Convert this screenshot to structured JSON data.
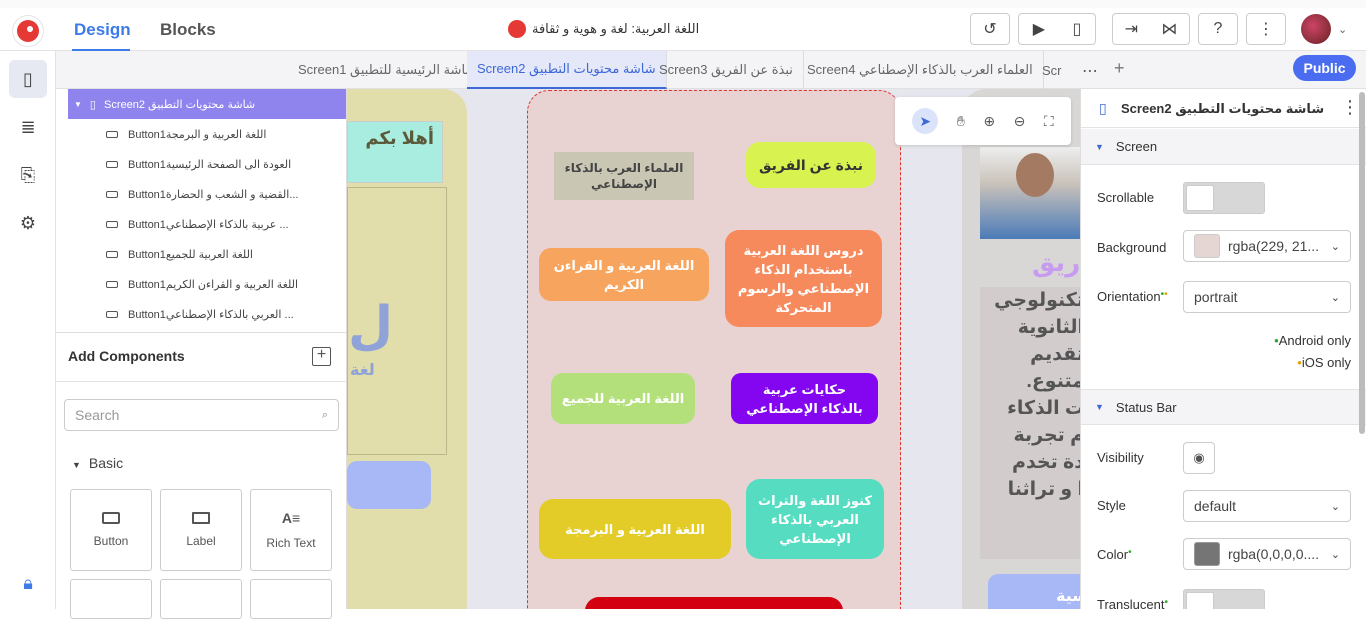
{
  "header": {
    "tabs": [
      "Design",
      "Blocks"
    ],
    "app_title": "اللغة العربية: لغة و هوية و ثقافة",
    "icons": [
      "history-icon",
      "preview-icon",
      "device-icon",
      "export-icon",
      "share-icon",
      "help-icon",
      "more-vert-icon"
    ]
  },
  "rail": {
    "icons": [
      "screen-icon",
      "database-icon",
      "assets-icon",
      "settings-icon",
      "lock-icon"
    ]
  },
  "screen_tabs": [
    "Screen1 الشاشة الرئيسية للتطبيق",
    "Screen2 شاشة محتويات التطبيق",
    "Screen3 نبذة عن الفريق",
    "Screen4 العلماء العرب بالذكاء الإصطناعي",
    "Scr"
  ],
  "publish_label": "Public",
  "tree": {
    "root": "Screen2 شاشة محتويات التطبيق",
    "items": [
      "Button1اللغة العربية و البرمجة",
      "Button1العودة الى الصفحة الرئيسية",
      "Button1القضية و الشعب و الحضارة...",
      "Button1عربية بالذكاء الإصطناعي ...",
      "Button1اللغة العربية للجميع",
      "Button1اللغة العربية و القراءن الكريم",
      "Button1العربي بالذكاء الإصطناعي ..."
    ]
  },
  "add_components": {
    "title": "Add Components",
    "search_placeholder": "Search",
    "group": "Basic",
    "items": [
      "Button",
      "Label",
      "Rich Text"
    ]
  },
  "canvas": {
    "left_screen_text": "أهلا بكم",
    "left_logo_text": "لغة",
    "buttons": [
      {
        "text": "العلماء العرب بالذكاء الإصطناعي",
        "bg": "#cac6b4",
        "color": "#444444"
      },
      {
        "text": "نبذة عن الفريق",
        "bg": "#d8f250",
        "color": "#333333"
      },
      {
        "text": "اللغة العربية و القراءن الكريم",
        "bg": "#f7a55e",
        "color": "#ffffff"
      },
      {
        "text": "دروس اللغة العربية باستخدام الذكاء الإصطناعي والرسوم المتحركة",
        "bg": "#f78a5c",
        "color": "#ffffff"
      },
      {
        "text": "اللغة العربية للجميع",
        "bg": "#b4e07c",
        "color": "#ffffff"
      },
      {
        "text": "حكايات عربية بالذكاء الإصطناعي",
        "bg": "#8406f0",
        "color": "#ffffff"
      },
      {
        "text": "اللغة العربية و البرمجة",
        "bg": "#e3cc27",
        "color": "#ffffff"
      },
      {
        "text": "كنوز اللغة والتراث العربي بالذكاء الإصطناعي",
        "bg": "#56dcc0",
        "color": "#ffffff"
      }
    ],
    "right_screen_title": "ريق",
    "right_screen_lines": [
      "تكنولوجي",
      "الثانوية",
      "تقديم",
      "متنوع.",
      "ت الذكاء",
      "م تجربة",
      "دة تخدم",
      "ا و تراثنا"
    ],
    "right_screen_button": "سية"
  },
  "properties": {
    "component_name": "Screen2 شاشة محتويات التطبيق",
    "sections": [
      "Screen",
      "Status Bar"
    ],
    "scrollable_label": "Scrollable",
    "background_label": "Background",
    "background_value": "rgba(229, 21...",
    "background_swatch": "#e5d5d3",
    "orientation_label": "Orientation",
    "orientation_value": "portrait",
    "android_only": "Android only",
    "ios_only": "iOS only",
    "visibility_label": "Visibility",
    "style_label": "Style",
    "style_value": "default",
    "color_label": "Color",
    "color_value": "rgba(0,0,0,0....",
    "color_swatch": "#757575",
    "translucent_label": "Translucent"
  }
}
